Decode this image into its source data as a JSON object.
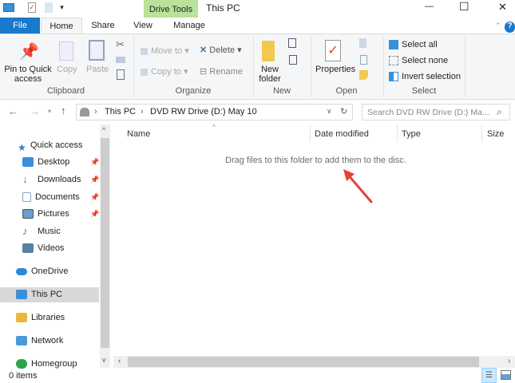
{
  "titlebar": {
    "context_tab": "Drive Tools",
    "title": "This PC",
    "minimize": "—",
    "maximize": "☐",
    "close": "✕"
  },
  "tabs": [
    {
      "label": "File"
    },
    {
      "label": "Home"
    },
    {
      "label": "Share"
    },
    {
      "label": "View"
    },
    {
      "label": "Manage"
    }
  ],
  "ribbon": {
    "clipboard": {
      "pin": "Pin to Quick access",
      "copy": "Copy",
      "paste": "Paste",
      "label": "Clipboard"
    },
    "organize": {
      "move_to": "Move to",
      "copy_to": "Copy to",
      "delete": "Delete",
      "rename": "Rename",
      "label": "Organize"
    },
    "new": {
      "new_folder": "New folder",
      "label": "New"
    },
    "open": {
      "properties": "Properties",
      "label": "Open"
    },
    "select": {
      "select_all": "Select all",
      "select_none": "Select none",
      "invert": "Invert selection",
      "label": "Select"
    }
  },
  "address": {
    "crumbs": [
      "This PC",
      "DVD RW Drive (D:) May 10"
    ],
    "search_placeholder": "Search DVD RW Drive (D:) Ma..."
  },
  "columns": [
    "Name",
    "Date modified",
    "Type",
    "Size"
  ],
  "empty_message": "Drag files to this folder to add them to the disc.",
  "sidebar": [
    {
      "label": "Quick access",
      "color": "#2b7bd6"
    },
    {
      "label": "Desktop",
      "color": "#3b8fd9",
      "pinned": true
    },
    {
      "label": "Downloads",
      "color": "#2a7fd4",
      "pinned": true
    },
    {
      "label": "Documents",
      "color": "#8aa4c0",
      "pinned": true
    },
    {
      "label": "Pictures",
      "color": "#6a9fcf",
      "pinned": true
    },
    {
      "label": "Music",
      "color": "#2a7fd4"
    },
    {
      "label": "Videos",
      "color": "#5a7fa6"
    },
    {
      "label": "OneDrive",
      "color": "#2a8ad8"
    },
    {
      "label": "This PC",
      "color": "#3a90d8",
      "selected": true
    },
    {
      "label": "Libraries",
      "color": "#e8b840"
    },
    {
      "label": "Network",
      "color": "#4a9ad8"
    },
    {
      "label": "Homegroup",
      "color": "#2aa34a"
    }
  ],
  "status": {
    "items": "0 items"
  },
  "colors": {
    "file_tab": "#1979ca",
    "drive_tools": "#b9e29a",
    "arrow": "#e8413a",
    "selection": "#cce8ff"
  }
}
